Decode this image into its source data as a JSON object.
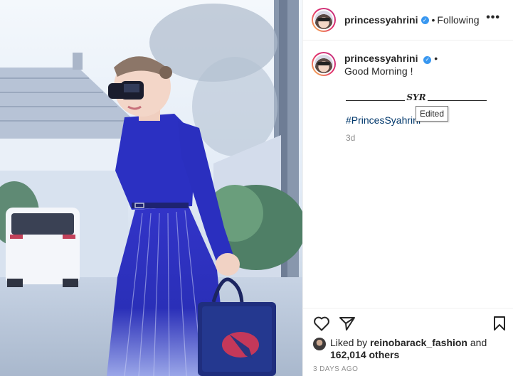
{
  "post": {
    "username": "princessyahrini",
    "verified_mark": "✓",
    "separator": "•",
    "follow_status": "Following",
    "more_label": "•••",
    "caption": {
      "username": "princessyahrini",
      "separator": "•",
      "text": "Good Morning !",
      "signature": "SYR",
      "hashtag": "#PrincesSyahrini",
      "edited_badge": "Edited",
      "time_ago": "3d"
    },
    "actions": {
      "like_icon": "heart-icon",
      "share_icon": "paper-plane-icon",
      "save_icon": "bookmark-icon"
    },
    "likes": {
      "prefix": "Liked by",
      "first_liker": "reinobarack_fashion",
      "and_word": "and",
      "others": "162,014 others"
    },
    "date": "3 DAYS AGO"
  },
  "colors": {
    "link": "#00376b",
    "verified": "#3897f0",
    "muted": "#8e8e8e",
    "dress": "#2d2fbf"
  }
}
